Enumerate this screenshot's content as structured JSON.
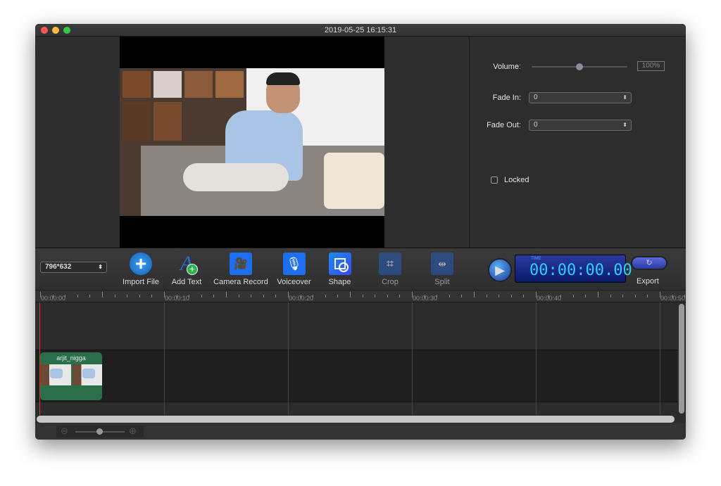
{
  "window": {
    "title": "2019-05-25 16:15:31"
  },
  "properties": {
    "volume_label": "Volume:",
    "volume_value": "100%",
    "volume_level": 0.5,
    "fade_in_label": "Fade In:",
    "fade_in_value": "0",
    "fade_out_label": "Fade Out:",
    "fade_out_value": "0",
    "locked_label": "Locked",
    "locked": false
  },
  "toolbar": {
    "resolution": "796*632",
    "import": "Import File",
    "add_text": "Add Text",
    "camera": "Camera Record",
    "voiceover": "Voiceover",
    "shape": "Shape",
    "crop": "Crop",
    "split": "Split",
    "time_label": "TIME",
    "time": "00:00:00.00",
    "export": "Export"
  },
  "ruler": [
    "00:00:00",
    "00:00:10",
    "00:00:20",
    "00:00:30",
    "00:00:40",
    "00:00:50"
  ],
  "clip": {
    "name": "arjit_nigga",
    "color": "#2a6e4a"
  },
  "colors": {
    "playhead": "#e0302a",
    "accent": "#1e6ef0"
  }
}
